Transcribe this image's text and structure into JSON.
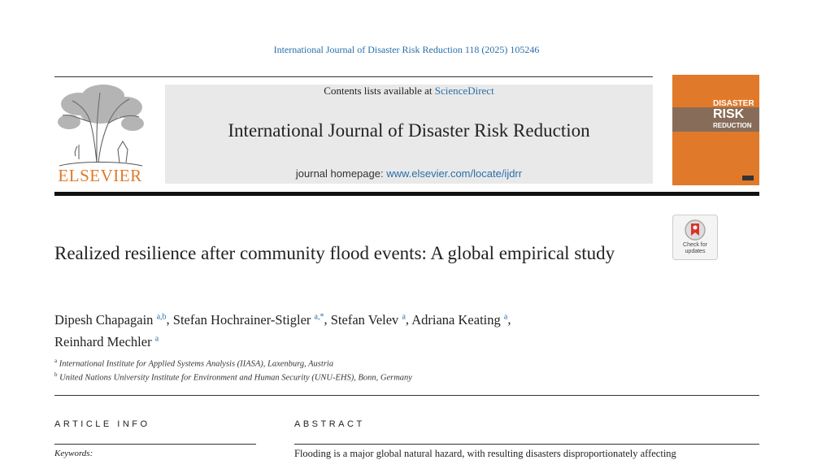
{
  "header": {
    "citation": "International Journal of Disaster Risk Reduction 118 (2025) 105246",
    "publisher": "ELSEVIER",
    "contents_prefix": "Contents lists available at ",
    "contents_link": "ScienceDirect",
    "journal_title": "International Journal of Disaster Risk Reduction",
    "homepage_prefix": "journal homepage: ",
    "homepage_link": "www.elsevier.com/locate/ijdrr",
    "cover_line1": "DISASTER",
    "cover_line2": "RISK",
    "cover_line3": "REDUCTION",
    "check_updates": "Check for updates"
  },
  "article": {
    "title": "Realized resilience after community flood events: A global empirical study",
    "authors": [
      {
        "name": "Dipesh Chapagain",
        "sup": "a,b",
        "sep": ", "
      },
      {
        "name": "Stefan Hochrainer-Stigler",
        "sup": "a,*",
        "sep": ", "
      },
      {
        "name": "Stefan Velev",
        "sup": "a",
        "sep": ", "
      },
      {
        "name": "Adriana Keating",
        "sup": "a",
        "sep": ","
      },
      {
        "name": "Reinhard Mechler",
        "sup": "a",
        "sep": ""
      }
    ],
    "affiliations": [
      {
        "mark": "a",
        "text": "International Institute for Applied Systems Analysis (IIASA), Laxenburg, Austria"
      },
      {
        "mark": "b",
        "text": "United Nations University Institute for Environment and Human Security (UNU-EHS), Bonn, Germany"
      }
    ]
  },
  "sections": {
    "article_info_heading": "ARTICLE INFO",
    "abstract_heading": "ABSTRACT",
    "keywords_label": "Keywords:",
    "abstract_start": "Flooding is a major global natural hazard, with resulting disasters disproportionately affecting"
  }
}
